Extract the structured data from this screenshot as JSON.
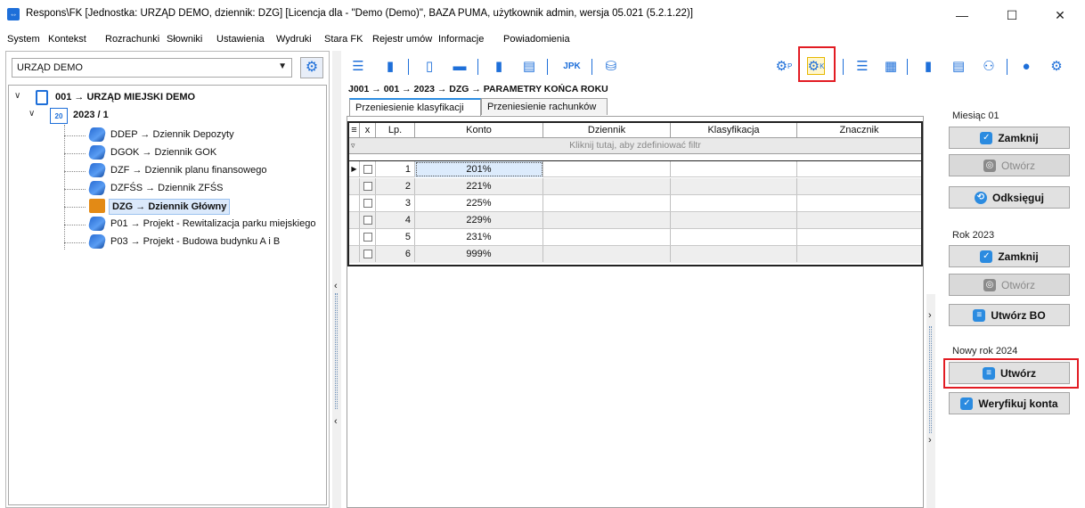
{
  "window": {
    "title": "Respons\\FK [Jednostka: URZĄD DEMO, dziennik: DZG] [Licencja dla - \"Demo (Demo)\", BAZA PUMA, użytkownik admin, wersja 05.021 (5.2.1.22)]",
    "minimize": "—",
    "maximize": "☐",
    "close": "✕"
  },
  "menu": [
    "System",
    "Kontekst",
    "Rozrachunki",
    "Słowniki",
    "Ustawienia",
    "Wydruki",
    "Stara FK",
    "Rejestr umów",
    "Informacje",
    "Powiadomienia"
  ],
  "unit_selector": {
    "value": "URZĄD DEMO",
    "arrow": "▼"
  },
  "tree": {
    "root": "001 → URZĄD MIEJSKI DEMO",
    "year": "2023 / 1",
    "year_icon_text": "20",
    "journals": [
      "DDEP → Dziennik Depozyty",
      "DGOK → Dziennik GOK",
      "DZF → Dziennik planu finansowego",
      "DZFŚS → Dziennik ZFŚS",
      "DZG → Dziennik Główny",
      "P01 → Projekt - Rewitalizacja parku miejskiego",
      "P03 → Projekt - Budowa budynku A i B"
    ],
    "selected_index": 4
  },
  "toolbar": {
    "jpk": "JPK",
    "p_superscript": "P",
    "k_superscript": "K"
  },
  "breadcrumb": "J001 → 001 → 2023 → DZG → PARAMETRY KOŃCA ROKU",
  "tabs": [
    "Przeniesienie klasyfikacji",
    "Przeniesienie rachunków"
  ],
  "grid": {
    "columns": [
      "x",
      "Lp.",
      "Konto",
      "Dziennik",
      "Klasyfikacja",
      "Znacznik"
    ],
    "filter_text": "Kliknij tutaj, aby zdefiniować filtr",
    "rows": [
      {
        "lp": "1",
        "konto": "201%"
      },
      {
        "lp": "2",
        "konto": "221%"
      },
      {
        "lp": "3",
        "konto": "225%"
      },
      {
        "lp": "4",
        "konto": "229%"
      },
      {
        "lp": "5",
        "konto": "231%"
      },
      {
        "lp": "6",
        "konto": "999%"
      }
    ]
  },
  "right_panel": {
    "month_group": "Miesiąc 01",
    "month_close": "Zamknij",
    "month_open": "Otwórz",
    "month_unbook": "Odksięguj",
    "year_group": "Rok 2023",
    "year_close": "Zamknij",
    "year_open": "Otwórz",
    "year_create_bo": "Utwórz BO",
    "new_year_group": "Nowy rok 2024",
    "new_year_create": "Utwórz",
    "verify_accounts": "Weryfikuj konta"
  },
  "colors": {
    "accent": "#1e6fd9",
    "highlight": "#e21c23",
    "selected_cell": "#dcebfc"
  }
}
